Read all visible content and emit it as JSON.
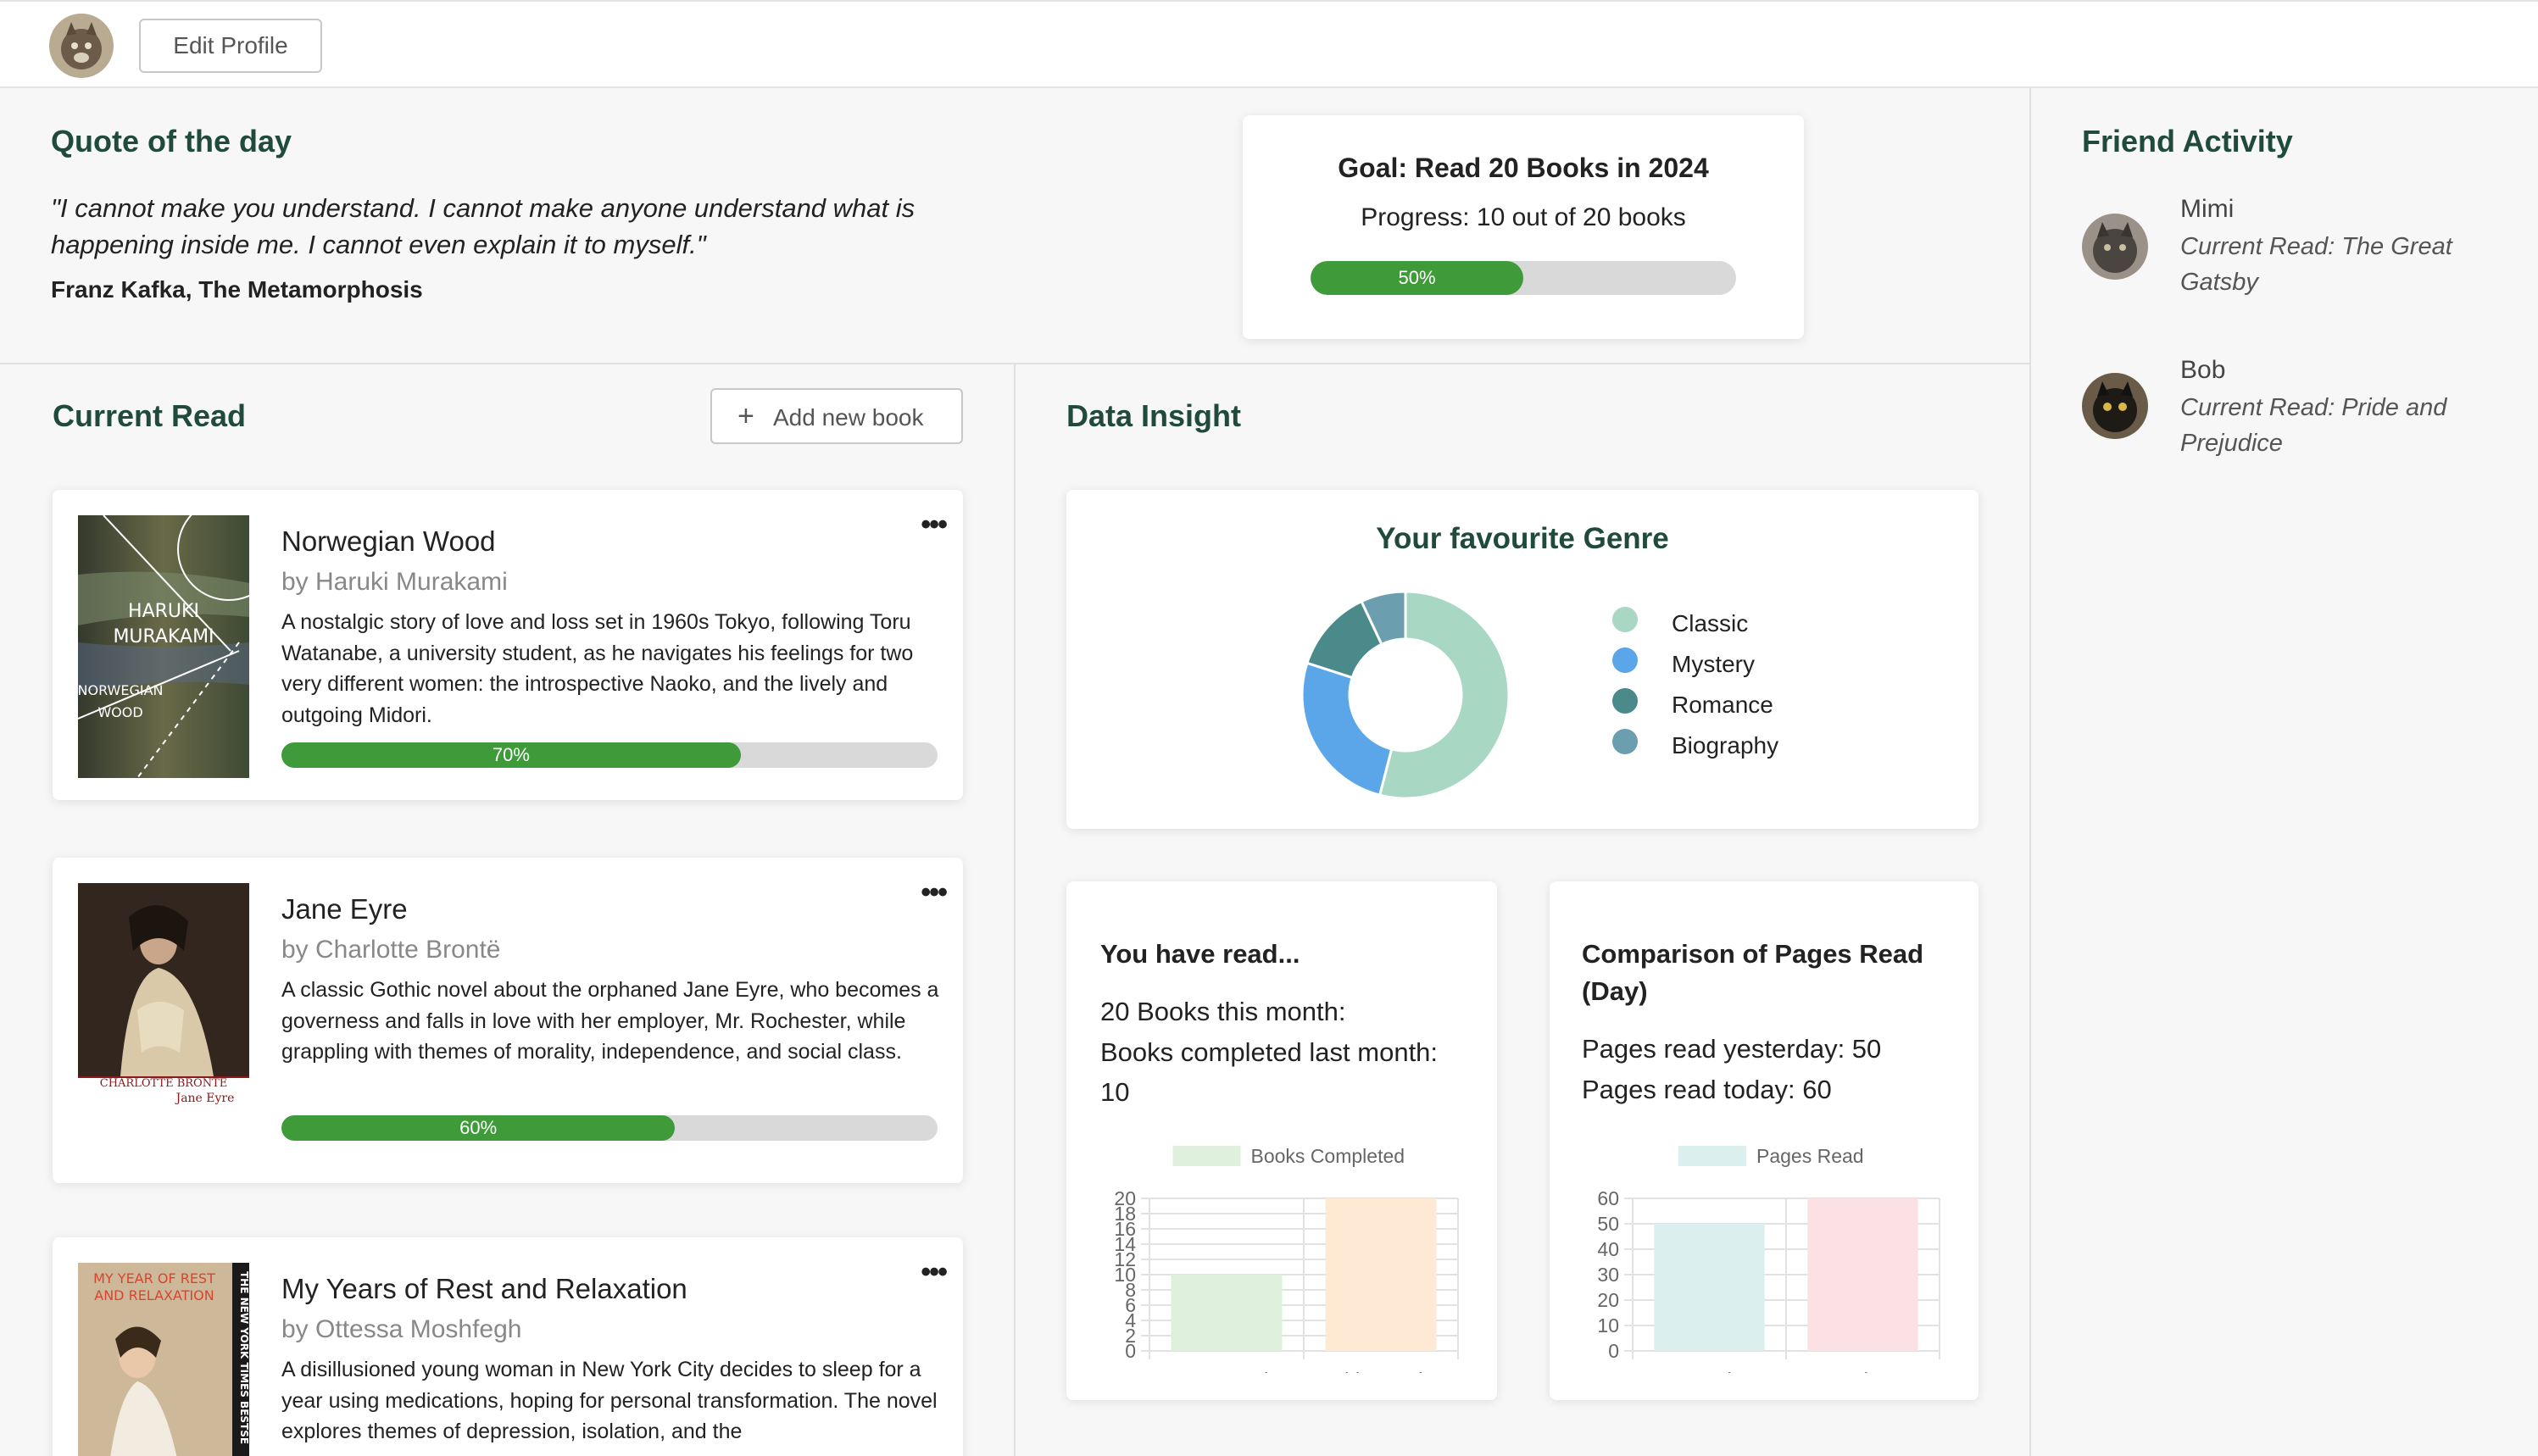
{
  "header": {
    "edit_profile_label": "Edit Profile",
    "avatar_icon": "cat-avatar"
  },
  "quote": {
    "heading": "Quote of the day",
    "text": "\"I cannot make you understand. I cannot make anyone understand what is happening inside me. I cannot even explain it to myself.\"",
    "author": "Franz Kafka, The Metamorphosis"
  },
  "goal": {
    "title": "Goal: Read 20 Books in 2024",
    "progress_text": "Progress: 10 out of 20 books",
    "percent": 50,
    "percent_label": "50%"
  },
  "current_read": {
    "heading": "Current Read",
    "add_button_label": "Add new book",
    "more_icon": "more-horizontal-icon",
    "books": [
      {
        "title": "Norwegian Wood",
        "author": "by Haruki Murakami",
        "description": "A nostalgic story of love and loss set in 1960s Tokyo, following Toru Watanabe, a university student, as he navigates his feelings for two very different women: the introspective Naoko, and the lively and outgoing Midori.",
        "progress": 70,
        "progress_label": "70%",
        "cover_text": [
          "HARUKI",
          "MURAKAMI",
          "NORWEGIAN",
          "WOOD"
        ]
      },
      {
        "title": "Jane Eyre",
        "author": "by Charlotte Brontë",
        "description": "A classic Gothic novel about the orphaned Jane Eyre, who becomes a governess and falls in love with her employer, Mr. Rochester, while grappling with themes of morality, independence, and social class.",
        "progress": 60,
        "progress_label": "60%",
        "cover_text": [
          "CHARLOTTE BRONTË",
          "Jane Eyre"
        ]
      },
      {
        "title": "My Years of Rest and Relaxation",
        "author": "by Ottessa Moshfegh",
        "description": "A disillusioned young woman in New York City decides to sleep for a year using medications, hoping for personal transformation. The novel explores themes of depression, isolation, and the",
        "cover_text": [
          "MY YEAR OF REST",
          "AND RELAXATION",
          "THE NEW YORK TIMES BESTSE"
        ]
      }
    ]
  },
  "insight": {
    "heading": "Data Insight",
    "genre_title": "Your favourite Genre",
    "genres": [
      {
        "name": "Classic",
        "value": 54,
        "color": "#a8d8c4"
      },
      {
        "name": "Mystery",
        "value": 26,
        "color": "#5aa6e8"
      },
      {
        "name": "Romance",
        "value": 13,
        "color": "#4a8a8a"
      },
      {
        "name": "Biography",
        "value": 7,
        "color": "#6b9fb0"
      }
    ],
    "books_read": {
      "title": "You have read...",
      "line1": "20 Books this month:",
      "line2": "Books completed last month: 10"
    },
    "pages_read": {
      "title": "Comparison of Pages Read (Day)",
      "line1": "Pages read yesterday: 50",
      "line2": "Pages read today: 60"
    }
  },
  "chart_data": [
    {
      "type": "bar",
      "series": [
        {
          "name": "Books Completed",
          "values": [
            10,
            20
          ]
        }
      ],
      "categories": [
        "Last Month",
        "This Month"
      ],
      "ylim": [
        0,
        20
      ],
      "yticks": [
        0,
        2,
        4,
        6,
        8,
        10,
        12,
        14,
        16,
        18,
        20
      ],
      "colors": [
        "#dff0dc",
        "#fde9d4"
      ],
      "legend_color": "#dff0dc",
      "grid": true
    },
    {
      "type": "bar",
      "series": [
        {
          "name": "Pages Read",
          "values": [
            50,
            60
          ]
        }
      ],
      "categories": [
        "Yesterday",
        "Today"
      ],
      "ylim": [
        0,
        60
      ],
      "yticks": [
        0,
        10,
        20,
        30,
        40,
        50,
        60
      ],
      "colors": [
        "#dcefef",
        "#fbe0e4"
      ],
      "legend_color": "#dcefef",
      "grid": true
    }
  ],
  "friends": {
    "heading": "Friend Activity",
    "items": [
      {
        "name": "Mimi",
        "current": "Current Read: The Great Gatsby"
      },
      {
        "name": "Bob",
        "current": "Current Read: Pride and Prejudice"
      }
    ]
  }
}
